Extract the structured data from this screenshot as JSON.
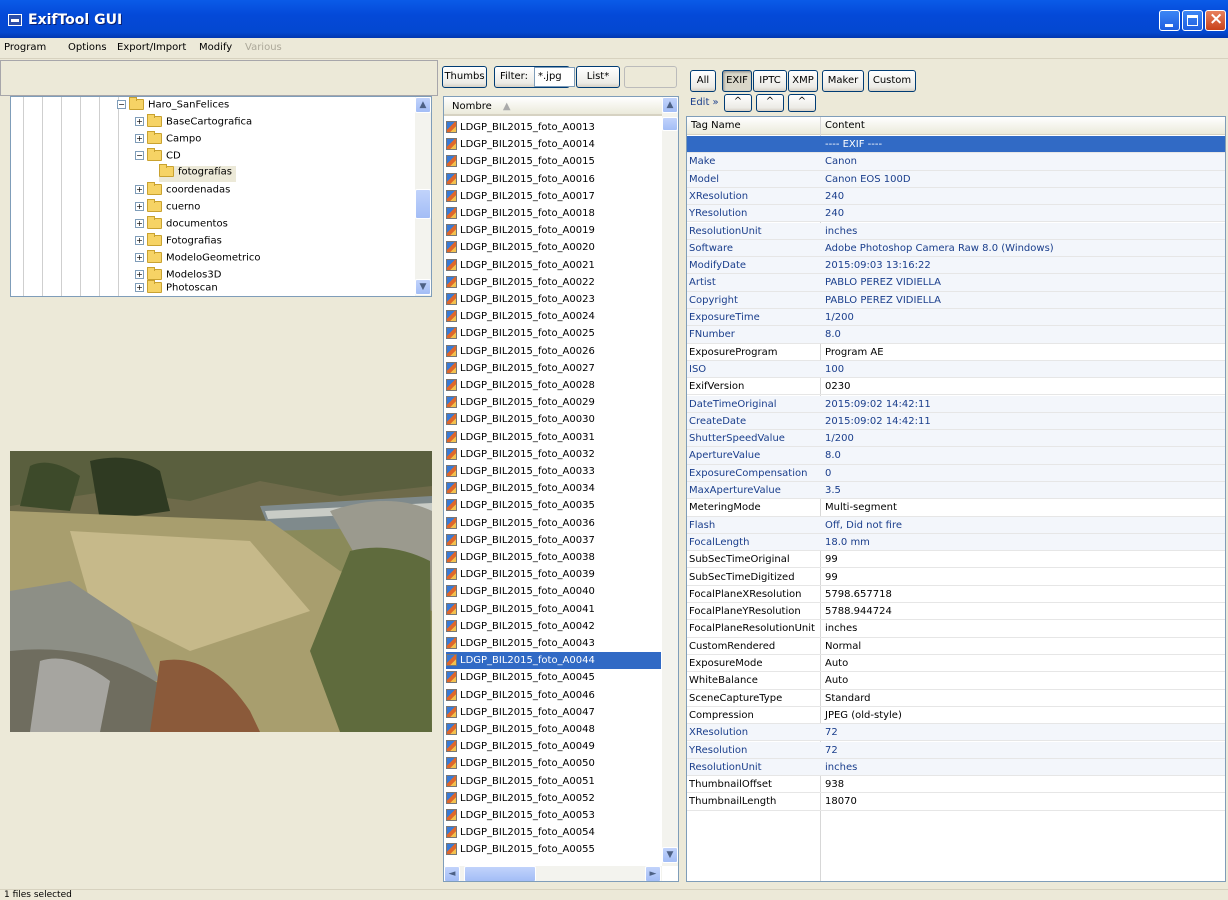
{
  "window": {
    "title": "ExifTool GUI"
  },
  "menu": [
    {
      "label": "Program",
      "disabled": false
    },
    {
      "label": "Options",
      "disabled": false
    },
    {
      "label": "Export/Import",
      "disabled": false
    },
    {
      "label": "Modify",
      "disabled": false
    },
    {
      "label": "Various",
      "disabled": true
    }
  ],
  "tree": {
    "items": [
      {
        "label": "Haro_SanFelices",
        "expander": "−",
        "level": 0
      },
      {
        "label": "BaseCartografica",
        "expander": "+",
        "level": 1
      },
      {
        "label": "Campo",
        "expander": "+",
        "level": 1
      },
      {
        "label": "CD",
        "expander": "−",
        "level": 1
      },
      {
        "label": "fotografías",
        "expander": "",
        "level": 2,
        "selected": true
      },
      {
        "label": "coordenadas",
        "expander": "+",
        "level": 1
      },
      {
        "label": "cuerno",
        "expander": "+",
        "level": 1
      },
      {
        "label": "documentos",
        "expander": "+",
        "level": 1
      },
      {
        "label": "Fotografias",
        "expander": "+",
        "level": 1
      },
      {
        "label": "ModeloGeometrico",
        "expander": "+",
        "level": 1
      },
      {
        "label": "Modelos3D",
        "expander": "+",
        "level": 1
      },
      {
        "label": "Photoscan",
        "expander": "+",
        "level": 1
      }
    ]
  },
  "filebar": {
    "thumbs": "Thumbs",
    "filter_label": "Filter:",
    "filter_value": "*.jpg",
    "list": "List*"
  },
  "filelist": {
    "header": "Nombre",
    "selected": "LDGP_BIL2015_foto_A0044",
    "files": [
      "LDGP_BIL2015_foto_A0013",
      "LDGP_BIL2015_foto_A0014",
      "LDGP_BIL2015_foto_A0015",
      "LDGP_BIL2015_foto_A0016",
      "LDGP_BIL2015_foto_A0017",
      "LDGP_BIL2015_foto_A0018",
      "LDGP_BIL2015_foto_A0019",
      "LDGP_BIL2015_foto_A0020",
      "LDGP_BIL2015_foto_A0021",
      "LDGP_BIL2015_foto_A0022",
      "LDGP_BIL2015_foto_A0023",
      "LDGP_BIL2015_foto_A0024",
      "LDGP_BIL2015_foto_A0025",
      "LDGP_BIL2015_foto_A0026",
      "LDGP_BIL2015_foto_A0027",
      "LDGP_BIL2015_foto_A0028",
      "LDGP_BIL2015_foto_A0029",
      "LDGP_BIL2015_foto_A0030",
      "LDGP_BIL2015_foto_A0031",
      "LDGP_BIL2015_foto_A0032",
      "LDGP_BIL2015_foto_A0033",
      "LDGP_BIL2015_foto_A0034",
      "LDGP_BIL2015_foto_A0035",
      "LDGP_BIL2015_foto_A0036",
      "LDGP_BIL2015_foto_A0037",
      "LDGP_BIL2015_foto_A0038",
      "LDGP_BIL2015_foto_A0039",
      "LDGP_BIL2015_foto_A0040",
      "LDGP_BIL2015_foto_A0041",
      "LDGP_BIL2015_foto_A0042",
      "LDGP_BIL2015_foto_A0043",
      "LDGP_BIL2015_foto_A0044",
      "LDGP_BIL2015_foto_A0045",
      "LDGP_BIL2015_foto_A0046",
      "LDGP_BIL2015_foto_A0047",
      "LDGP_BIL2015_foto_A0048",
      "LDGP_BIL2015_foto_A0049",
      "LDGP_BIL2015_foto_A0050",
      "LDGP_BIL2015_foto_A0051",
      "LDGP_BIL2015_foto_A0052",
      "LDGP_BIL2015_foto_A0053",
      "LDGP_BIL2015_foto_A0054",
      "LDGP_BIL2015_foto_A0055"
    ]
  },
  "tag_buttons": [
    "All",
    "EXIF",
    "IPTC",
    "XMP",
    "Maker",
    "Custom"
  ],
  "edit": {
    "label": "Edit »"
  },
  "table": {
    "headers": [
      "Tag Name",
      "Content"
    ],
    "rows": [
      {
        "tag": "",
        "value": "---- EXIF ----",
        "style": "sel"
      },
      {
        "tag": "Make",
        "value": "Canon",
        "style": "blue"
      },
      {
        "tag": "Model",
        "value": "Canon EOS 100D",
        "style": "blue"
      },
      {
        "tag": "XResolution",
        "value": "240",
        "style": "blue"
      },
      {
        "tag": "YResolution",
        "value": "240",
        "style": "blue"
      },
      {
        "tag": "ResolutionUnit",
        "value": "inches",
        "style": "blue"
      },
      {
        "tag": "Software",
        "value": "Adobe Photoshop Camera Raw 8.0 (Windows)",
        "style": "blue"
      },
      {
        "tag": "ModifyDate",
        "value": "2015:09:03 13:16:22",
        "style": "blue"
      },
      {
        "tag": "Artist",
        "value": "PABLO PEREZ VIDIELLA",
        "style": "blue"
      },
      {
        "tag": "Copyright",
        "value": "PABLO PEREZ VIDIELLA",
        "style": "blue"
      },
      {
        "tag": "ExposureTime",
        "value": "1/200",
        "style": "blue"
      },
      {
        "tag": "FNumber",
        "value": "8.0",
        "style": "blue"
      },
      {
        "tag": "ExposureProgram",
        "value": "Program AE",
        "style": ""
      },
      {
        "tag": "ISO",
        "value": "100",
        "style": "blue"
      },
      {
        "tag": "ExifVersion",
        "value": "0230",
        "style": ""
      },
      {
        "tag": "DateTimeOriginal",
        "value": "2015:09:02 14:42:11",
        "style": "blue"
      },
      {
        "tag": "CreateDate",
        "value": "2015:09:02 14:42:11",
        "style": "blue"
      },
      {
        "tag": "ShutterSpeedValue",
        "value": "1/200",
        "style": "blue"
      },
      {
        "tag": "ApertureValue",
        "value": "8.0",
        "style": "blue"
      },
      {
        "tag": "ExposureCompensation",
        "value": "0",
        "style": "blue"
      },
      {
        "tag": "MaxApertureValue",
        "value": "3.5",
        "style": "blue"
      },
      {
        "tag": "MeteringMode",
        "value": "Multi-segment",
        "style": ""
      },
      {
        "tag": "Flash",
        "value": "Off, Did not fire",
        "style": "blue"
      },
      {
        "tag": "FocalLength",
        "value": "18.0 mm",
        "style": "blue"
      },
      {
        "tag": "SubSecTimeOriginal",
        "value": "99",
        "style": ""
      },
      {
        "tag": "SubSecTimeDigitized",
        "value": "99",
        "style": ""
      },
      {
        "tag": "FocalPlaneXResolution",
        "value": "5798.657718",
        "style": ""
      },
      {
        "tag": "FocalPlaneYResolution",
        "value": "5788.944724",
        "style": ""
      },
      {
        "tag": "FocalPlaneResolutionUnit",
        "value": "inches",
        "style": ""
      },
      {
        "tag": "CustomRendered",
        "value": "Normal",
        "style": ""
      },
      {
        "tag": "ExposureMode",
        "value": "Auto",
        "style": ""
      },
      {
        "tag": "WhiteBalance",
        "value": "Auto",
        "style": ""
      },
      {
        "tag": "SceneCaptureType",
        "value": "Standard",
        "style": ""
      },
      {
        "tag": "Compression",
        "value": "JPEG (old-style)",
        "style": ""
      },
      {
        "tag": "XResolution",
        "value": "72",
        "style": "blue"
      },
      {
        "tag": "YResolution",
        "value": "72",
        "style": "blue"
      },
      {
        "tag": "ResolutionUnit",
        "value": "inches",
        "style": "blue"
      },
      {
        "tag": "ThumbnailOffset",
        "value": "938",
        "style": ""
      },
      {
        "tag": "ThumbnailLength",
        "value": "18070",
        "style": ""
      }
    ]
  },
  "status": {
    "text": "1 files selected"
  },
  "colors": {
    "titlebar": "#0449D8",
    "selection": "#316AC5",
    "tagBlue": "#1A3E8C"
  },
  "icons": {
    "minimize": "minimize-icon",
    "maximize": "maximize-icon",
    "close": "close-icon"
  }
}
